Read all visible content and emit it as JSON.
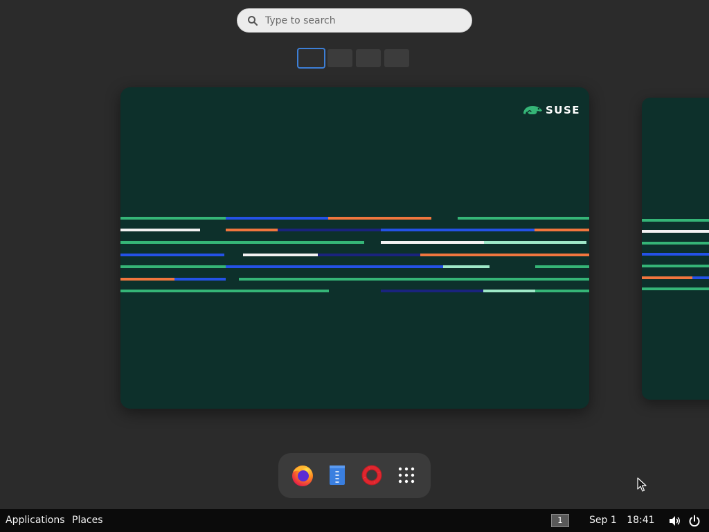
{
  "search": {
    "placeholder": "Type to search",
    "icon": "search-icon"
  },
  "workspaces": {
    "count": 4,
    "active_index": 0
  },
  "wallpaper": {
    "brand": "SUSE",
    "background_color": "#0d302b"
  },
  "dash": {
    "items": [
      {
        "name": "Firefox",
        "icon": "firefox-icon"
      },
      {
        "name": "Text Editor",
        "icon": "text-editor-icon"
      },
      {
        "name": "Help",
        "icon": "help-lifebuoy-icon"
      },
      {
        "name": "Show Applications",
        "icon": "app-grid-icon"
      }
    ]
  },
  "topbar": {
    "applications_label": "Applications",
    "places_label": "Places",
    "workspace_indicator": "1",
    "clock": {
      "date": "Sep 1",
      "time": "18:41"
    },
    "icons": [
      "volume-icon",
      "power-icon"
    ]
  },
  "colors": {
    "accent": "#3d7fd6",
    "green": "#35b577",
    "blue": "#2452e6",
    "orange": "#f0763e",
    "white": "#f2f2f2",
    "navy": "#1a237e",
    "mint": "#9ee8c8"
  }
}
